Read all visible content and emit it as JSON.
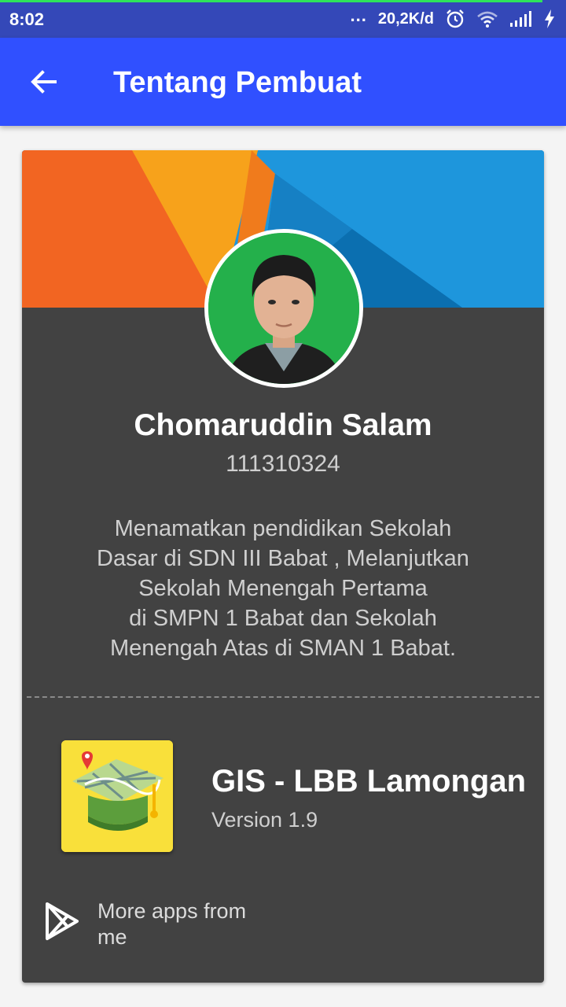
{
  "status_bar": {
    "time": "8:02",
    "indicators": "...",
    "network_speed": "20,2K/d",
    "icons": [
      "alarm-icon",
      "wifi-icon",
      "signal-icon",
      "charging-icon"
    ]
  },
  "app_bar": {
    "back_icon": "arrow-back-icon",
    "title": "Tentang Pembuat",
    "color": "#3050ff"
  },
  "profile": {
    "name": "Chomaruddin Salam",
    "id_number": "111310324",
    "description": "Menamatkan pendidikan Sekolah\nDasar di SDN III Babat , Melanjutkan\nSekolah Menengah Pertama\ndi SMPN 1 Babat dan Sekolah\nMenengah Atas di SMAN 1 Babat."
  },
  "app_info": {
    "icon": "map-graduation-cap-icon",
    "name": "GIS - LBB Lamongan",
    "version": "Version 1.9"
  },
  "more_apps": {
    "icon": "play-store-icon",
    "label": "More apps from me"
  },
  "colors": {
    "card_background": "#424242",
    "banner_orange": "#f26522",
    "banner_amber": "#f7a21b",
    "banner_blue": "#1e96dc",
    "avatar_background": "#24b04b"
  }
}
